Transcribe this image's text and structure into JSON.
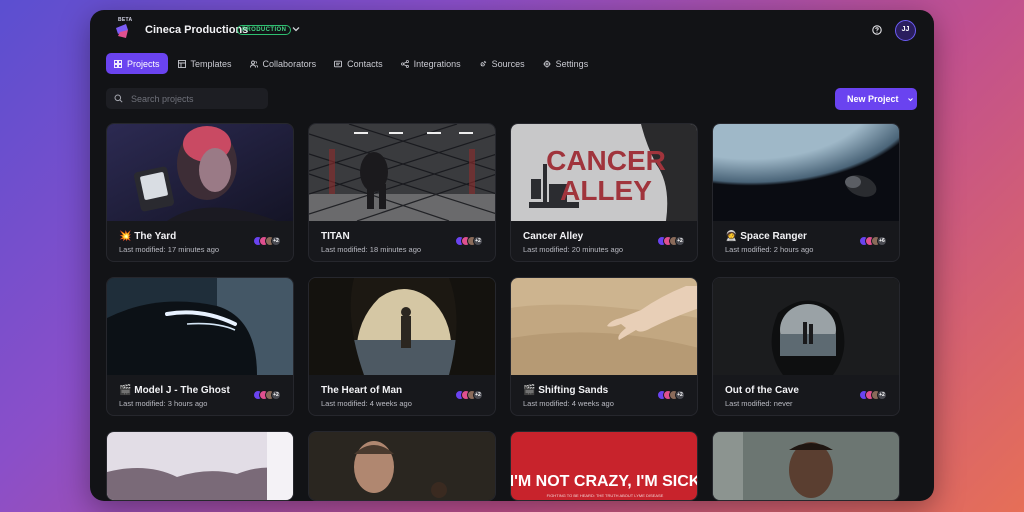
{
  "org": {
    "name": "Cineca Productions",
    "badge": "PRODUCTION",
    "beta": "BETA"
  },
  "user": {
    "initials": "JJ"
  },
  "tabs": [
    {
      "label": "Projects",
      "icon": "grid-icon",
      "active": true
    },
    {
      "label": "Templates",
      "icon": "template-icon"
    },
    {
      "label": "Collaborators",
      "icon": "users-icon"
    },
    {
      "label": "Contacts",
      "icon": "contact-card-icon"
    },
    {
      "label": "Integrations",
      "icon": "share-nodes-icon"
    },
    {
      "label": "Sources",
      "icon": "plug-icon"
    },
    {
      "label": "Settings",
      "icon": "gear-icon"
    }
  ],
  "search": {
    "placeholder": "Search projects"
  },
  "new_project": {
    "label": "New Project"
  },
  "projects": [
    {
      "emoji": "💥",
      "title": "The Yard",
      "modified": "Last modified: 17 minutes ago",
      "extra": "+2"
    },
    {
      "emoji": "",
      "title": "TITAN",
      "modified": "Last modified: 18 minutes ago",
      "extra": "+2"
    },
    {
      "emoji": "",
      "title": "Cancer Alley",
      "modified": "Last modified: 20 minutes ago",
      "extra": "+2"
    },
    {
      "emoji": "🧑‍🚀",
      "title": "Space Ranger",
      "modified": "Last modified: 2 hours ago",
      "extra": "+6"
    },
    {
      "emoji": "🎬",
      "title": "Model J - The Ghost",
      "modified": "Last modified: 3 hours ago",
      "extra": "+2"
    },
    {
      "emoji": "",
      "title": "The Heart of Man",
      "modified": "Last modified: 4 weeks ago",
      "extra": "+2"
    },
    {
      "emoji": "🎬",
      "title": "Shifting Sands",
      "modified": "Last modified: 4 weeks ago",
      "extra": "+2"
    },
    {
      "emoji": "",
      "title": "Out of the Cave",
      "modified": "Last modified: never",
      "extra": "+2"
    }
  ],
  "thumb_text": {
    "cancer_alley_1": "CANCER",
    "cancer_alley_2": "ALLEY",
    "sick_poster": "I'M NOT CRAZY, I'M SICK",
    "sick_tagline": "FIGHTING TO BE HEARD: THE TRUTH ABOUT LYME DISEASE"
  },
  "colors": {
    "accent": "#6a43f0",
    "badge": "#2fbf71",
    "background": "#121316"
  }
}
